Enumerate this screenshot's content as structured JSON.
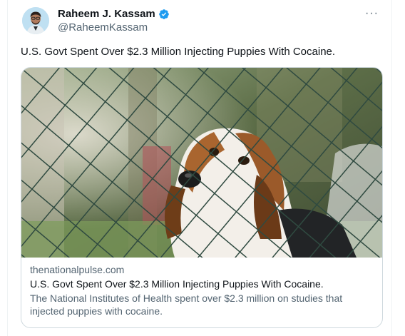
{
  "author": {
    "name": "Raheem J. Kassam",
    "handle": "@RaheemKassam",
    "verified": true,
    "verified_color": "#1d9bf0"
  },
  "tweet": {
    "text": "U.S. Govt Spent Over $2.3 Million Injecting Puppies With Cocaine."
  },
  "menu": {
    "more_icon": "···"
  },
  "card": {
    "domain": "thenationalpulse.com",
    "title": "U.S. Govt Spent Over $2.3 Million Injecting Puppies With Cocaine.",
    "description": "The National Institutes of Health spent over $2.3 million on studies that injected puppies with cocaine."
  }
}
